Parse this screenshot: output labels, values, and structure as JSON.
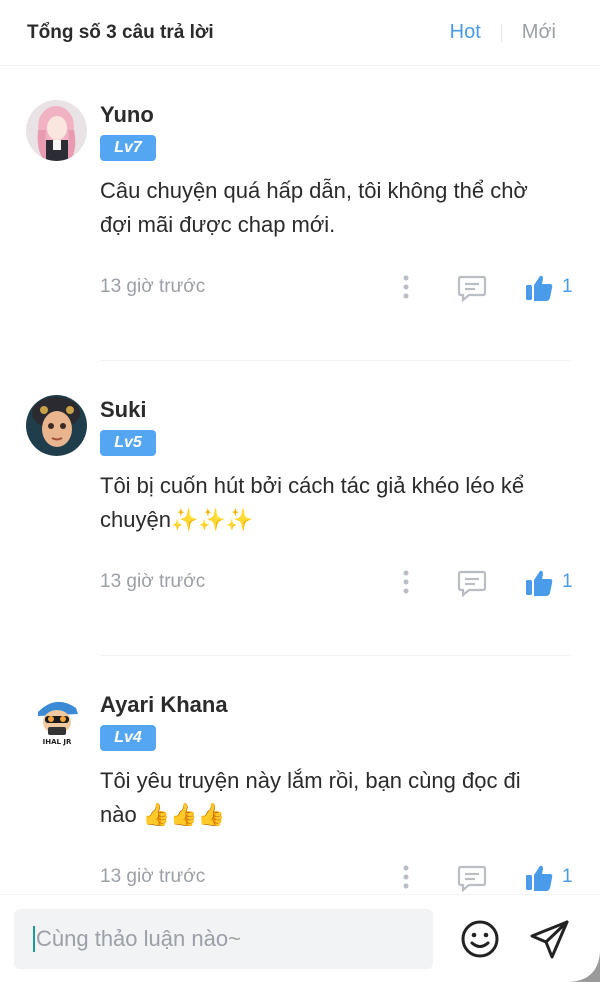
{
  "header": {
    "total_label": "Tổng số 3 câu trả lời",
    "sort_hot": "Hot",
    "sort_new": "Mới"
  },
  "comments": [
    {
      "user": "Yuno",
      "level": "Lv7",
      "text": "Câu chuyện quá hấp dẫn, tôi không thể chờ đợi mãi được chap mới.",
      "time": "13 giờ trước",
      "likes": "1"
    },
    {
      "user": "Suki",
      "level": "Lv5",
      "text": "Tôi bị cuốn hút bởi cách tác giả khéo léo kể chuyện✨✨✨",
      "time": "13 giờ trước",
      "likes": "1"
    },
    {
      "user": "Ayari Khana",
      "level": "Lv4",
      "text": "Tôi yêu truyện này lắm rồi, bạn cùng đọc đi nào 👍👍👍",
      "time": "13 giờ trước",
      "likes": "1"
    }
  ],
  "input": {
    "placeholder": "Cùng thảo luận nào~"
  },
  "icons": {
    "more": "more-vertical-icon",
    "reply": "comment-icon",
    "like": "thumbs-up-icon",
    "emoji": "smiley-icon",
    "send": "send-icon"
  },
  "colors": {
    "accent": "#4a9be9",
    "badge": "#55a6f2",
    "muted": "#9aa0a6"
  }
}
